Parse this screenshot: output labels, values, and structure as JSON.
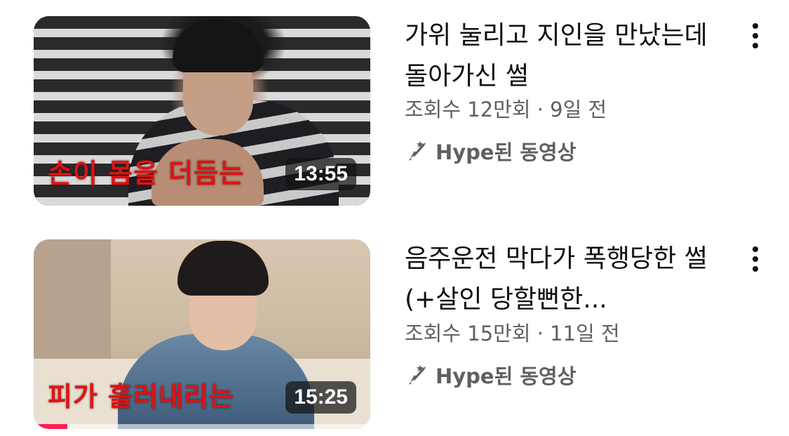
{
  "videos": [
    {
      "thumbnail_caption": "손이 몸을 더듬는",
      "duration": "13:55",
      "title": "가위 눌리고 지인을 만났는데 돌아가신 썰",
      "meta": "조회수 12만회 · 9일 전",
      "hype_label": "Hype된 동영상",
      "icon": "more-vert-icon"
    },
    {
      "thumbnail_caption": "피가 흘러내리는",
      "duration": "15:25",
      "title": "음주운전 막다가 폭행당한 썰 (+살인 당할뻔한...",
      "meta": "조회수 15만회 · 11일 전",
      "hype_label": "Hype된 동영상",
      "watch_progress": 0.1,
      "icon": "more-vert-icon"
    }
  ],
  "colors": {
    "caption_red": "#e01212",
    "progress_red": "#ff1f4f",
    "meta_gray": "#606060"
  },
  "icons": {
    "hype": "hype-rocket-icon",
    "more": "more-vert-icon"
  }
}
